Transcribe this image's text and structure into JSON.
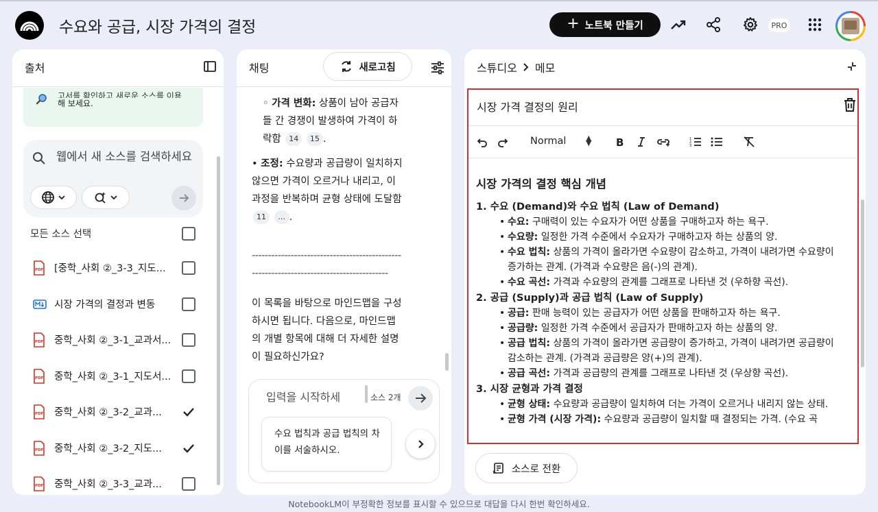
{
  "app": {
    "title": "수요와 공급, 시장 가격의 결정",
    "create_notebook_label": "노트북 만들기",
    "pro_badge": "PRO",
    "footer": "NotebookLM이 부정확한 정보를 표시할 수 있으므로 대답을 다시 한번 확인하세요."
  },
  "icons": {
    "logo": "notebooklm-logo-icon",
    "analytics": "trending-up-icon",
    "share": "share-icon",
    "settings": "gear-icon",
    "apps": "apps-grid-icon"
  },
  "colors": {
    "accent_dark": "#0f0f0f",
    "hint_bg": "#eaf7ee",
    "pdf_red": "#d93025",
    "md_blue": "#1a73e8",
    "highlight_border": "#d32f2f",
    "page_bg": "#ebeef8"
  },
  "sources": {
    "title": "출처",
    "hint_line1": "고서를 확인하고 새로운 소스를 이용",
    "hint_line2": "해 보세요.",
    "search_placeholder": "웹에서 새 소스를 검색하세요",
    "select_all_label": "모든 소스 선택",
    "items": [
      {
        "type": "pdf",
        "label": "[중학_사회 ②_3-3_지도...",
        "checked": false
      },
      {
        "type": "md",
        "label": "시장 가격의 결정과 변동",
        "checked": false
      },
      {
        "type": "pdf",
        "label": "중학_사회 ②_3-1_교과서...",
        "checked": false
      },
      {
        "type": "pdf",
        "label": "중학_사회 ②_3-1_지도서...",
        "checked": false
      },
      {
        "type": "pdf",
        "label": "중학_사회 ②_3-2_교과...",
        "checked": true
      },
      {
        "type": "pdf",
        "label": "중학_사회 ②_3-2_지도...",
        "checked": true
      },
      {
        "type": "pdf",
        "label": "중학_사회 ②_3-3_교과...",
        "checked": false
      }
    ]
  },
  "chat": {
    "title": "채팅",
    "refresh_label": "새로고침",
    "price_change_label": "가격 변화:",
    "price_change_text": "상품이 남아 공급자들 간 경쟁이 발생하여 가격이 하락함",
    "price_change_cites": [
      "14",
      "15"
    ],
    "adjust_label": "조정:",
    "adjust_text": "수요량과 공급량이 일치하지 않으면 가격이 오르거나 내리고, 이 과정을 반복하며 균형 상태에 도달함",
    "adjust_cites": [
      "11",
      "..."
    ],
    "dashes": "----------------------------------------------------------------------------------------",
    "closing_text": "이 목록을 바탕으로 마인드맵을 구성하시면 됩니다. 다음으로, 마인드맵의 개별 항목에 대해 더 자세한 설명이 필요하신가요?",
    "input_placeholder": "입력을 시작하세요...",
    "source_count": "소스 2개",
    "suggestion": "수요 법칙과 공급 법칙의 차이를 서술하시오."
  },
  "studio": {
    "crumb_root": "스튜디오",
    "crumb_current": "메모",
    "note_title": "시장 가격 결정의 원리",
    "format_select": "Normal",
    "convert_label": "소스로 전환",
    "heading": "시장 가격의 결정 핵심 개념",
    "sections": [
      {
        "title": "1. 수요 (Demand)와 수요 법칙 (Law of Demand)",
        "items": [
          {
            "term": "수요:",
            "text": "구매력이 있는 수요자가 어떤 상품을 구매하고자 하는 욕구."
          },
          {
            "term": "수요량:",
            "text": "일정한 가격 수준에서 수요자가 구매하고자 하는 상품의 양."
          },
          {
            "term": "수요 법칙:",
            "text": "상품의 가격이 올라가면 수요량이 감소하고, 가격이 내려가면 수요량이 증가하는 관계. (가격과 수요량은 음(-)의 관계)."
          },
          {
            "term": "수요 곡선:",
            "text": "가격과 수요량의 관계를 그래프로 나타낸 것 (우하향 곡선)."
          }
        ]
      },
      {
        "title": "2. 공급 (Supply)과 공급 법칙 (Law of Supply)",
        "items": [
          {
            "term": "공급:",
            "text": "판매 능력이 있는 공급자가 어떤 상품을 판매하고자 하는 욕구."
          },
          {
            "term": "공급량:",
            "text": "일정한 가격 수준에서 공급자가 판매하고자 하는 상품의 양."
          },
          {
            "term": "공급 법칙:",
            "text": "상품의 가격이 올라가면 공급량이 증가하고, 가격이 내려가면 공급량이 감소하는 관계. (가격과 공급량은 양(+)의 관계)."
          },
          {
            "term": "공급 곡선:",
            "text": "가격과 공급량의 관계를 그래프로 나타낸 것 (우상향 곡선)."
          }
        ]
      },
      {
        "title": "3. 시장 균형과 가격 결정",
        "items": [
          {
            "term": "균형 상태:",
            "text": "수요량과 공급량이 일치하여 더는 가격이 오르거나 내리지 않는 상태."
          },
          {
            "term": "균형 가격 (시장 가격):",
            "text": "수요량과 공급량이 일치할 때 결정되는 가격. (수요 곡"
          }
        ]
      }
    ]
  }
}
